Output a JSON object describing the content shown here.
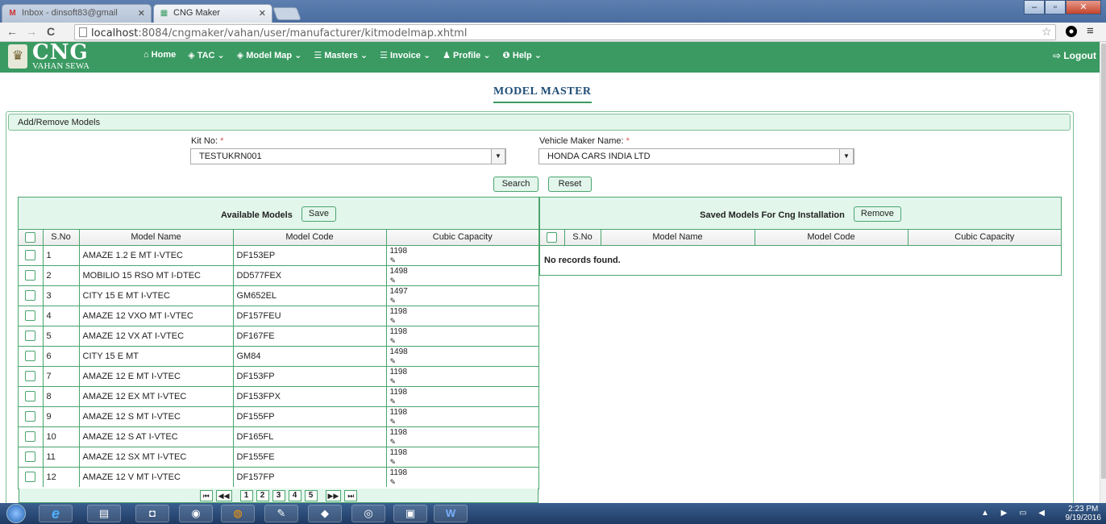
{
  "browser": {
    "tabs": [
      {
        "title": "Inbox - dinsoft83@gmail"
      },
      {
        "title": "CNG Maker"
      }
    ],
    "url_host": "localhost",
    "url_path": ":8084/cngmaker/vahan/user/manufacturer/kitmodelmap.xhtml"
  },
  "header": {
    "brand_big": "CNG",
    "brand_small": "VAHAN SEWA",
    "nav": [
      {
        "label": "Home",
        "icon": "home-icon"
      },
      {
        "label": "TAC",
        "icon": "tag-icon",
        "caret": "⌄"
      },
      {
        "label": "Model Map",
        "icon": "tag-icon",
        "caret": "⌄"
      },
      {
        "label": "Masters",
        "icon": "list-icon",
        "caret": "⌄"
      },
      {
        "label": "Invoice",
        "icon": "list-icon",
        "caret": "⌄"
      },
      {
        "label": "Profile",
        "icon": "user-icon",
        "caret": "⌄"
      },
      {
        "label": "Help",
        "icon": "info-icon",
        "caret": "⌄"
      }
    ],
    "logout_label": "Logout"
  },
  "page": {
    "title": "MODEL MASTER",
    "panel_title": "Add/Remove Models",
    "kit_label": "Kit No:",
    "kit_value": "TESTUKRN001",
    "maker_label": "Vehicle Maker Name:",
    "maker_value": "HONDA CARS INDIA LTD",
    "required_mark": "*",
    "search_label": "Search",
    "reset_label": "Reset"
  },
  "available": {
    "title": "Available Models",
    "save_label": "Save",
    "columns": [
      "S.No",
      "Model Name",
      "Model Code",
      "Cubic Capacity"
    ],
    "rows": [
      {
        "sno": "1",
        "name": "AMAZE 1.2 E MT I-VTEC",
        "code": "DF153EP",
        "cc": "1198"
      },
      {
        "sno": "2",
        "name": "MOBILIO 15 RSO MT I-DTEC",
        "code": "DD577FEX",
        "cc": "1498"
      },
      {
        "sno": "3",
        "name": "CITY 15 E MT I-VTEC",
        "code": "GM652EL",
        "cc": "1497"
      },
      {
        "sno": "4",
        "name": "AMAZE 12 VXO MT I-VTEC",
        "code": "DF157FEU",
        "cc": "1198"
      },
      {
        "sno": "5",
        "name": "AMAZE 12 VX AT I-VTEC",
        "code": "DF167FE",
        "cc": "1198"
      },
      {
        "sno": "6",
        "name": "CITY 15 E MT",
        "code": "GM84",
        "cc": "1498"
      },
      {
        "sno": "7",
        "name": "AMAZE 12 E MT I-VTEC",
        "code": "DF153FP",
        "cc": "1198"
      },
      {
        "sno": "8",
        "name": "AMAZE 12 EX MT I-VTEC",
        "code": "DF153FPX",
        "cc": "1198"
      },
      {
        "sno": "9",
        "name": "AMAZE 12 S MT I-VTEC",
        "code": "DF155FP",
        "cc": "1198"
      },
      {
        "sno": "10",
        "name": "AMAZE 12 S AT I-VTEC",
        "code": "DF165FL",
        "cc": "1198"
      },
      {
        "sno": "11",
        "name": "AMAZE 12 SX MT I-VTEC",
        "code": "DF155FE",
        "cc": "1198"
      },
      {
        "sno": "12",
        "name": "AMAZE 12 V MT I-VTEC",
        "code": "DF157FP",
        "cc": "1198"
      }
    ],
    "pages": [
      "1",
      "2",
      "3",
      "4",
      "5"
    ],
    "pager_first": "⏮",
    "pager_prev": "◀◀",
    "pager_next": "▶▶",
    "pager_last": "⏭"
  },
  "saved": {
    "title": "Saved Models For Cng Installation",
    "remove_label": "Remove",
    "columns": [
      "S.No",
      "Model Name",
      "Model Code",
      "Cubic Capacity"
    ],
    "empty_text": "No records found."
  },
  "taskbar": {
    "time": "2:23 PM",
    "date": "9/19/2016"
  },
  "colors": {
    "header_green": "#3a9a62",
    "panel_tint": "#e3f6ec",
    "border_green": "#4aa46e",
    "title_blue": "#1f4e79"
  }
}
